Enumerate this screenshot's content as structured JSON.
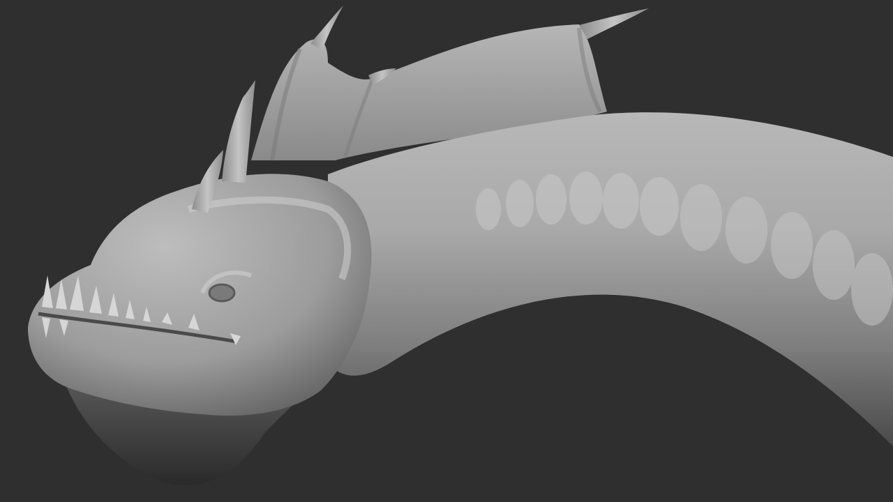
{
  "scene": {
    "background_color": "#2f2f2f",
    "subject": "sea-serpent-sculpt",
    "material_color": "#9a9a9a",
    "highlight_color": "#cfcfcf",
    "shadow_color": "#3a3a3a"
  }
}
